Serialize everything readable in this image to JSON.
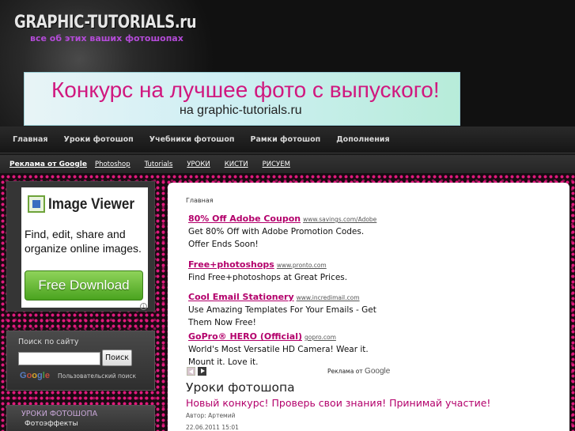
{
  "header": {
    "logo": "GRAPHIC-TUTORIALS.ru",
    "slogan": "все об этих ваших фотошопах",
    "banner_line1": "Конкурс на лучшее фото с выпуского!",
    "banner_line2": "на graphic-tutorials.ru"
  },
  "main_nav": {
    "items": [
      {
        "label": "Главная"
      },
      {
        "label": "Уроки фотошоп"
      },
      {
        "label": "Учебники фотошоп"
      },
      {
        "label": "Рамки фотошоп"
      },
      {
        "label": "Дополнения"
      }
    ]
  },
  "ad_bar": {
    "label": "Реклама от Google",
    "links": [
      "Photoshop",
      "Tutorials",
      "УРОКИ",
      "КИСТИ",
      "РИСУЕМ"
    ]
  },
  "sidebar": {
    "image_ad": {
      "title": "Image Viewer",
      "tagline": "Find, edit, share and organize online images.",
      "button": "Free Download",
      "info_icon": "info-icon"
    },
    "search": {
      "title": "Поиск по сайту",
      "input_value": "",
      "button": "Поиск",
      "google_logo": "Google",
      "custom_label": "Пользовательский поиск"
    },
    "menu": {
      "title": "УРОКИ ФОТОШОПА",
      "items": [
        "Фотоэффекты"
      ]
    }
  },
  "content": {
    "breadcrumb": "Главная",
    "ads": [
      {
        "title": "80% Off Adobe Coupon",
        "url": "www.savings.com/Adobe",
        "desc": "Get 80% Off with Adobe Promotion Codes. Offer Ends Soon!"
      },
      {
        "title": "Free+photoshops",
        "url": "www.pronto.com",
        "desc": "Find Free+photoshops at Great Prices."
      },
      {
        "title": "Cool Email Stationery",
        "url": "www.incredimail.com",
        "desc": "Use Amazing Templates For Your Emails - Get Them Now Free!"
      },
      {
        "title": "GoPro® HERO (Official)",
        "url": "gopro.com",
        "desc": "World's Most Versatile HD Camera! Wear it. Mount it. Love it."
      }
    ],
    "ads_by_google_prefix": "Реклама от",
    "ads_by_google_brand": "Google",
    "section_title": "Уроки фотошопа",
    "post": {
      "title": "Новый конкурс! Проверь свои знания! Принимай участие!",
      "author": "Автор: Артемий",
      "date": "22.06.2011 15:01"
    }
  },
  "colors": {
    "accent_pink": "#b3006b",
    "slogan_purple": "#b44bd8",
    "dots_pink": "#e0197c"
  }
}
